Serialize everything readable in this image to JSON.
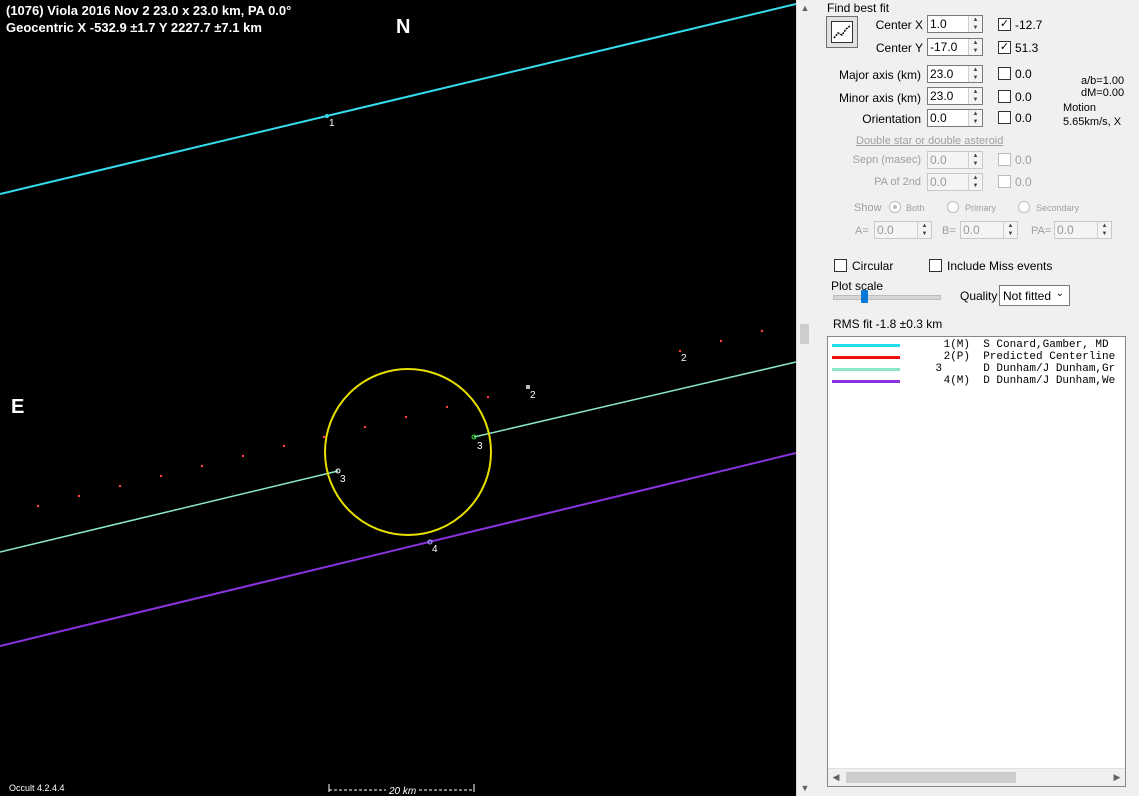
{
  "plot": {
    "title_line1": "(1076) Viola  2016 Nov 2   23.0 x 23.0 km, PA 0.0°",
    "title_line2": "Geocentric  X  -532.9 ±1.7  Y 2227.7 ±7.1 km",
    "north_label": "N",
    "east_label": "E",
    "scale_label": "20 km",
    "version": "Occult 4.2.4.4",
    "chord_labels": [
      "1",
      "2",
      "2",
      "3",
      "3",
      "4"
    ],
    "colors": {
      "background": "#000000",
      "chord1": "#33ddee",
      "chord3": "#88e8c8",
      "chord4": "#8833dd",
      "ellipse": "#e8e000",
      "predicted": "#ff3333"
    }
  },
  "panel": {
    "find_best_fit": "Find best fit",
    "center_x": {
      "label": "Center X",
      "value": "1.0",
      "checked": true,
      "fit": "-12.7"
    },
    "center_y": {
      "label": "Center Y",
      "value": "-17.0",
      "checked": true,
      "fit": "51.3"
    },
    "major_axis": {
      "label": "Major axis (km)",
      "value": "23.0",
      "checked": false,
      "fit": "0.0"
    },
    "minor_axis": {
      "label": "Minor axis (km)",
      "value": "23.0",
      "checked": false,
      "fit": "0.0"
    },
    "orientation": {
      "label": "Orientation",
      "value": "0.0",
      "checked": false,
      "fit": "0.0"
    },
    "ab_ratio": "a/b=1.00",
    "dm": "dM=0.00",
    "motion_label": "Motion",
    "motion_value": "5.65km/s, X",
    "double_star": "Double star  or  double asteroid",
    "sepn": {
      "label": "Sepn (masec)",
      "value": "0.0",
      "fit": "0.0"
    },
    "pa2": {
      "label": "PA of 2nd",
      "value": "0.0",
      "fit": "0.0"
    },
    "show_label": "Show",
    "show_options": [
      "Both",
      "Primary",
      "Secondary"
    ],
    "a_label": "A=",
    "a_value": "0.0",
    "b_label": "B=",
    "b_value": "0.0",
    "pa_label": "PA=",
    "pa_value": "0.0",
    "circular": "Circular",
    "include_miss": "Include Miss events",
    "plot_scale": "Plot scale",
    "quality_label": "Quality",
    "quality_value": "Not fitted",
    "rms_fit": "RMS fit -1.8 ±0.3 km",
    "observers": [
      {
        "id": "1(M)",
        "name": "S Conard,Gamber, MD",
        "color": "#22ddee"
      },
      {
        "id": "2(P)",
        "name": "Predicted Centerline",
        "color": "#ee1111"
      },
      {
        "id": "3",
        "name": "D Dunham/J Dunham,Gr",
        "color": "#88e8c8"
      },
      {
        "id": "4(M)",
        "name": "D Dunham/J Dunham,We",
        "color": "#8833dd"
      }
    ]
  }
}
